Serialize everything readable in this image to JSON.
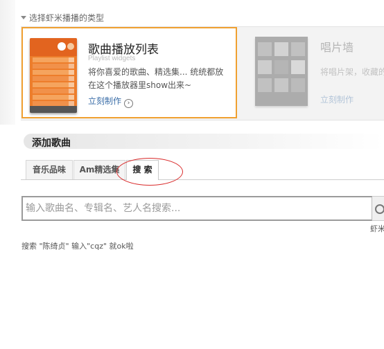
{
  "type_section": {
    "label": "选择虾米播播的类型"
  },
  "card_playlist": {
    "title": "歌曲播放列表",
    "subtitle": "Playlist widgets",
    "description": "将你喜爱的歌曲、精选集... 统统都放在这个播放器里show出来~",
    "link": "立刻制作",
    "accent_color": "#f0a030"
  },
  "card_wall": {
    "title": "唱片墙",
    "description": "将唱片架，收藏的统统显示在你的",
    "link": "立刻制作"
  },
  "add_songs": {
    "title": "添加歌曲"
  },
  "tabs": [
    {
      "label": "音乐品味",
      "active": false
    },
    {
      "label": "Am精选集",
      "active": false
    },
    {
      "label": "搜 索",
      "active": true
    }
  ],
  "search": {
    "placeholder": "输入歌曲名、专辑名、艺人名搜索...",
    "value": "",
    "icon": "search-icon"
  },
  "side_hint": "虾米",
  "tip": "搜索 \"陈绮贞\" 输入\"cqz\" 就ok啦",
  "annotation_color": "#d92a2a"
}
